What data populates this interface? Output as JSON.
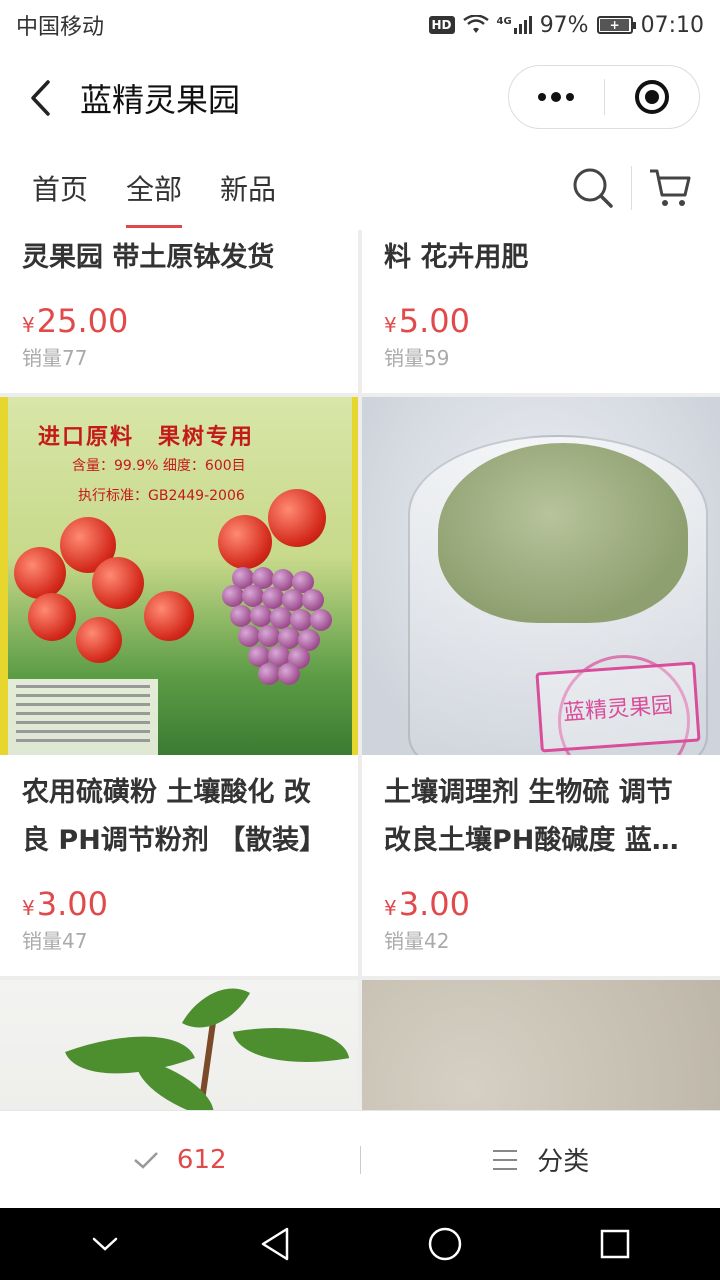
{
  "status_bar": {
    "carrier": "中国移动",
    "hd": "HD",
    "network": "4G",
    "battery_percent": "97%",
    "battery_level": 0.97,
    "time": "07:10"
  },
  "header": {
    "back_icon": "chevron-left-icon",
    "title": "蓝精灵果园",
    "more_icon": "more-dots-icon",
    "close_icon": "target-close-icon"
  },
  "tabs": [
    {
      "label": "首页",
      "active": false
    },
    {
      "label": "全部",
      "active": true
    },
    {
      "label": "新品",
      "active": false
    }
  ],
  "tab_icons": {
    "search": "search-icon",
    "cart": "cart-icon"
  },
  "products": [
    {
      "title": "蓝莓两年苗 包杯成 蓝精灵果园 带土原钵发货",
      "currency": "¥",
      "price": "25.00",
      "sales": "销量77"
    },
    {
      "title": "斑得尔 蓝莓专用 水溶肥料 花卉用肥",
      "currency": "¥",
      "price": "5.00",
      "sales": "销量59"
    },
    {
      "title": "农用硫磺粉 土壤酸化 改良 PH调节粉剂 【散装】",
      "currency": "¥",
      "price": "3.00",
      "sales": "销量47",
      "image_text": {
        "banner": "进口原料　果树专用",
        "spec": "含量：99.9%  细度：600目",
        "standard": "执行标准：GB2449-2006"
      }
    },
    {
      "title": "土壤调理剂 生物硫 调节改良土壤PH酸碱度 蓝精灵果园",
      "currency": "¥",
      "price": "3.00",
      "sales": "销量42",
      "image_text": {
        "stamp": "蓝精灵果园"
      }
    }
  ],
  "bottom_bar": {
    "check_icon": "check-icon",
    "count": "612",
    "category_icon": "list-icon",
    "category_label": "分类"
  },
  "system_nav": {
    "back": "triangle-back-icon",
    "home": "circle-home-icon",
    "recent": "square-recent-icon",
    "hide": "chevron-down-icon"
  },
  "colors": {
    "accent": "#e04a4a",
    "sales_gray": "#aaaaaa",
    "background": "#ededed"
  }
}
